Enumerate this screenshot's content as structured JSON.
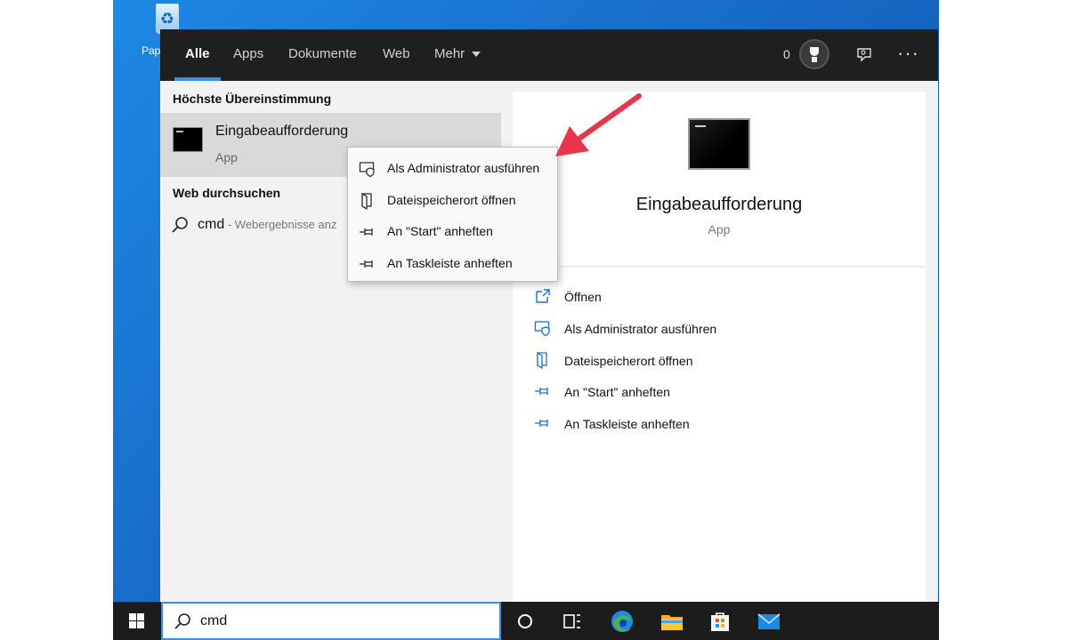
{
  "desktop": {
    "recycle_bin_label": "Pap"
  },
  "tabs": [
    {
      "label": "Alle"
    },
    {
      "label": "Apps"
    },
    {
      "label": "Dokumente"
    },
    {
      "label": "Web"
    },
    {
      "label": "Mehr"
    }
  ],
  "topbar": {
    "points": "0",
    "icons": [
      "trophy-icon",
      "feedback-icon",
      "more-icon"
    ]
  },
  "left": {
    "best_match_title": "Höchste Übereinstimmung",
    "best_match": {
      "name": "Eingabeaufforderung",
      "type": "App"
    },
    "web_title": "Web durchsuchen",
    "web_query": "cmd",
    "web_hint": " - Webergebnisse anz"
  },
  "context_menu": {
    "items": [
      {
        "label": "Als Administrator ausführen",
        "icon": "shield-icon"
      },
      {
        "label": "Dateispeicherort öffnen",
        "icon": "folder-icon"
      },
      {
        "label": "An \"Start\" anheften",
        "icon": "pin-icon"
      },
      {
        "label": "An Taskleiste anheften",
        "icon": "pin-icon"
      }
    ]
  },
  "right": {
    "app_name": "Eingabeaufforderung",
    "app_type": "App",
    "actions": [
      {
        "label": "Öffnen",
        "icon": "open-icon"
      },
      {
        "label": "Als Administrator ausführen",
        "icon": "shield-icon"
      },
      {
        "label": "Dateispeicherort öffnen",
        "icon": "folder-icon"
      },
      {
        "label": "An \"Start\" anheften",
        "icon": "pin-icon"
      },
      {
        "label": "An Taskleiste anheften",
        "icon": "pin-icon"
      }
    ]
  },
  "taskbar": {
    "search_value": "cmd",
    "icons": [
      "windows-logo-icon",
      "cortana-icon",
      "task-view-icon",
      "edge-icon",
      "file-explorer-icon",
      "store-icon",
      "mail-icon"
    ]
  },
  "colors": {
    "accent": "#3a8ee6",
    "arrow": "#e8354a",
    "action_icon": "#1a73c8"
  }
}
